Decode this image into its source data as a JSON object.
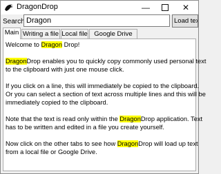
{
  "window": {
    "title": "DragonDrop",
    "controls": {
      "minimize": "—",
      "close": "✕"
    }
  },
  "search": {
    "label": "Search:",
    "value": "Dragon",
    "button": "Load text"
  },
  "tabs": [
    "Main",
    "Writing a file",
    "Local file",
    "Google Drive file"
  ],
  "active_tab": "Main",
  "highlight_color": "#ffff00",
  "content": {
    "p1": {
      "a": "Welcome to ",
      "hl": "Dragon",
      "b": " Drop!"
    },
    "p2l1": {
      "hl": "Dragon",
      "b": "Drop enables you to quickly copy commonly used personal text"
    },
    "p2l2": "to the clipboard with just one mouse click.",
    "p3l1": "If you click on a line, this will immediately be copied to the clipboard.",
    "p3l2": "Or you can select a section of text across multiple lines and this will be",
    "p3l3": "immediately copied to the clipboard.",
    "p4l1": {
      "a": "Note that the text is read only within the ",
      "hl": "Dragon",
      "b": "Drop application. Text"
    },
    "p4l2": "has to be written and edited in a file you create yourself.",
    "p5l1": {
      "a": "Now click on the other tabs to see how ",
      "hl": "Dragon",
      "b": "Drop will load up text"
    },
    "p5l2": "from a local file or Google Drive."
  }
}
